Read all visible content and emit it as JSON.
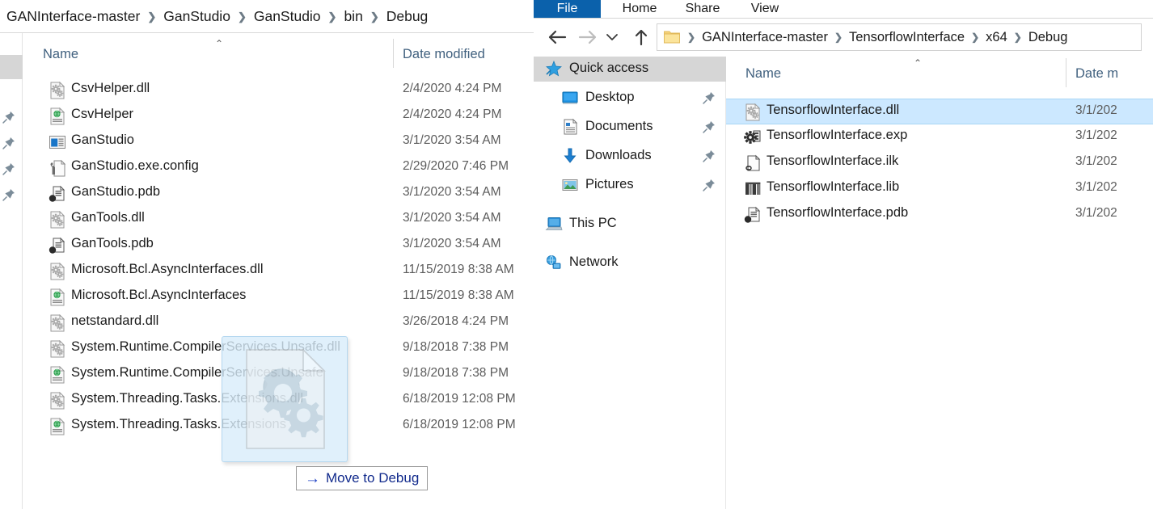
{
  "left_window": {
    "breadcrumb": {
      "name": "breadcrumb-left",
      "parts": [
        "GANInterface-master",
        "GanStudio",
        "GanStudio",
        "bin",
        "Debug"
      ],
      "separator": "❯"
    },
    "columns": {
      "name": "Name",
      "date_modified": "Date modified",
      "sort_caret": "⌃"
    },
    "files": [
      {
        "name": "CsvHelper.dll",
        "date": "2/4/2020 4:24 PM",
        "icon": "dll-file-icon"
      },
      {
        "name": "CsvHelper",
        "date": "2/4/2020 4:24 PM",
        "icon": "xml-file-icon"
      },
      {
        "name": "GanStudio",
        "date": "3/1/2020 3:54 AM",
        "icon": "application-exe-icon"
      },
      {
        "name": "GanStudio.exe.config",
        "date": "2/29/2020 7:46 PM",
        "icon": "config-file-icon"
      },
      {
        "name": "GanStudio.pdb",
        "date": "3/1/2020 3:54 AM",
        "icon": "pdb-file-icon"
      },
      {
        "name": "GanTools.dll",
        "date": "3/1/2020 3:54 AM",
        "icon": "dll-file-icon"
      },
      {
        "name": "GanTools.pdb",
        "date": "3/1/2020 3:54 AM",
        "icon": "pdb-file-icon"
      },
      {
        "name": "Microsoft.Bcl.AsyncInterfaces.dll",
        "date": "11/15/2019 8:38 AM",
        "icon": "dll-file-icon"
      },
      {
        "name": "Microsoft.Bcl.AsyncInterfaces",
        "date": "11/15/2019 8:38 AM",
        "icon": "xml-file-icon"
      },
      {
        "name": "netstandard.dll",
        "date": "3/26/2018 4:24 PM",
        "icon": "dll-file-icon"
      },
      {
        "name": "System.Runtime.CompilerServices.Unsafe.dll",
        "date": "9/18/2018 7:38 PM",
        "icon": "dll-file-icon"
      },
      {
        "name": "System.Runtime.CompilerServices.Unsafe",
        "date": "9/18/2018 7:38 PM",
        "icon": "xml-file-icon"
      },
      {
        "name": "System.Threading.Tasks.Extensions.dll",
        "date": "6/18/2019 12:08 PM",
        "icon": "dll-file-icon"
      },
      {
        "name": "System.Threading.Tasks.Extensions",
        "date": "6/18/2019 12:08 PM",
        "icon": "xml-file-icon"
      }
    ]
  },
  "drag": {
    "ghost_name": "drag-ghost-preview",
    "ghost_icon": "dll-file-icon-large",
    "tooltip": {
      "arrow": "→",
      "label": "Move to Debug"
    }
  },
  "right_window": {
    "ribbon_tabs": [
      {
        "label": "File",
        "active": true
      },
      {
        "label": "Home",
        "active": false
      },
      {
        "label": "Share",
        "active": false
      },
      {
        "label": "View",
        "active": false
      }
    ],
    "nav_buttons": {
      "back": "back-arrow-icon",
      "forward": "forward-arrow-icon",
      "recent": "recent-locations-chevron-icon",
      "up": "up-arrow-icon"
    },
    "address_bar": {
      "folder_icon": "folder-icon",
      "parts": [
        "GANInterface-master",
        "TensorflowInterface",
        "x64",
        "Debug"
      ],
      "separator": "❯"
    },
    "nav_pane": [
      {
        "label": "Quick access",
        "icon": "quick-access-star-icon",
        "level": 0,
        "selected": true,
        "pinned": false
      },
      {
        "label": "Desktop",
        "icon": "desktop-icon",
        "level": 1,
        "selected": false,
        "pinned": true
      },
      {
        "label": "Documents",
        "icon": "documents-icon",
        "level": 1,
        "selected": false,
        "pinned": true
      },
      {
        "label": "Downloads",
        "icon": "downloads-icon",
        "level": 1,
        "selected": false,
        "pinned": true
      },
      {
        "label": "Pictures",
        "icon": "pictures-icon",
        "level": 1,
        "selected": false,
        "pinned": true
      },
      {
        "label": "This PC",
        "icon": "this-pc-icon",
        "level": 0,
        "selected": false,
        "pinned": false
      },
      {
        "label": "Network",
        "icon": "network-icon",
        "level": 0,
        "selected": false,
        "pinned": false
      }
    ],
    "columns": {
      "name": "Name",
      "date_modified": "Date m",
      "sort_caret": "⌃"
    },
    "files": [
      {
        "name": "TensorflowInterface.dll",
        "date": "3/1/202",
        "icon": "dll-file-icon",
        "selected": true
      },
      {
        "name": "TensorflowInterface.exp",
        "date": "3/1/202",
        "icon": "exp-file-icon",
        "selected": false
      },
      {
        "name": "TensorflowInterface.ilk",
        "date": "3/1/202",
        "icon": "ilk-file-icon",
        "selected": false
      },
      {
        "name": "TensorflowInterface.lib",
        "date": "3/1/202",
        "icon": "lib-file-icon",
        "selected": false
      },
      {
        "name": "TensorflowInterface.pdb",
        "date": "3/1/202",
        "icon": "pdb-file-icon",
        "selected": false
      }
    ]
  },
  "colors": {
    "accent_blue": "#0b61ab",
    "selection_blue": "#cce8ff",
    "header_text": "#41617f",
    "nav_selected_gray": "#d6d6d6",
    "tooltip_text": "#112a8c"
  }
}
